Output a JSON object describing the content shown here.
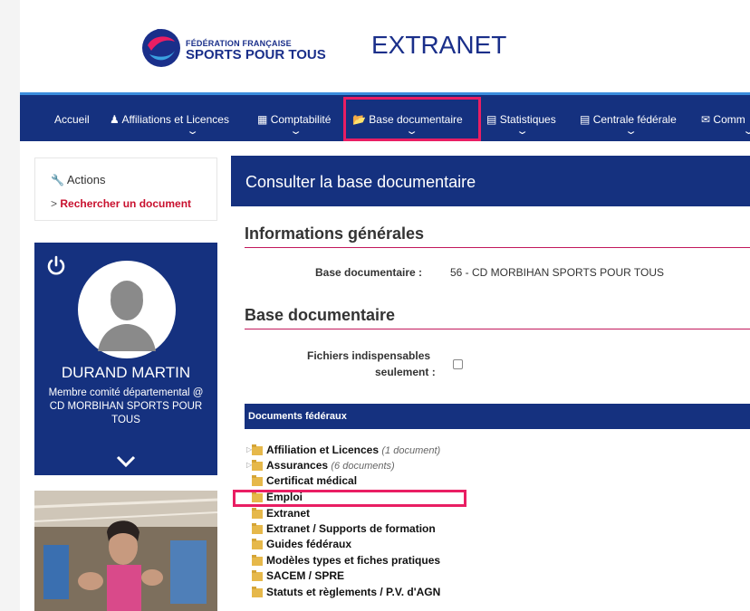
{
  "header": {
    "logo_line1": "FÉDÉRATION FRANÇAISE",
    "logo_line2": "SPORTS POUR TOUS",
    "app_title": "EXTRANET"
  },
  "nav": {
    "items": [
      {
        "label": "Accueil",
        "icon": "none"
      },
      {
        "label": "Affiliations et Licences",
        "icon": "user-icon"
      },
      {
        "label": "Comptabilité",
        "icon": "calculator-icon"
      },
      {
        "label": "Base documentaire",
        "icon": "folder-open-icon"
      },
      {
        "label": "Statistiques",
        "icon": "bar-chart-icon"
      },
      {
        "label": "Centrale fédérale",
        "icon": "list-icon"
      },
      {
        "label": "Comm",
        "icon": "envelope-icon"
      }
    ]
  },
  "sidebar": {
    "actions_title": "Actions",
    "actions_link": "Rechercher un document",
    "user_name": "DURAND MARTIN",
    "user_role": "Membre comité départemental @ CD MORBIHAN SPORTS POUR TOUS"
  },
  "main": {
    "page_title": "Consulter la base documentaire",
    "section1_title": "Informations générales",
    "base_label": "Base documentaire :",
    "base_value": "56 - CD MORBIHAN SPORTS POUR TOUS",
    "section2_title": "Base documentaire",
    "filter_label_line1": "Fichiers indispensables",
    "filter_label_line2": "seulement :",
    "filter_checked": false,
    "docs_header": "Documents fédéraux",
    "tree": [
      {
        "label": "Affiliation et Licences",
        "count": "(1 document)",
        "expandable": true
      },
      {
        "label": "Assurances",
        "count": "(6 documents)",
        "expandable": true
      },
      {
        "label": "Certificat médical",
        "count": "",
        "expandable": false
      },
      {
        "label": "Emploi",
        "count": "",
        "expandable": false
      },
      {
        "label": "Extranet",
        "count": "",
        "expandable": false
      },
      {
        "label": "Extranet / Supports de formation",
        "count": "",
        "expandable": false
      },
      {
        "label": "Guides fédéraux",
        "count": "",
        "expandable": false
      },
      {
        "label": "Modèles types et fiches pratiques",
        "count": "",
        "expandable": false
      },
      {
        "label": "SACEM / SPRE",
        "count": "",
        "expandable": false
      },
      {
        "label": "Statuts et règlements / P.V. d'AGN",
        "count": "",
        "expandable": false
      }
    ]
  },
  "colors": {
    "navy": "#15317f",
    "highlight": "#e91e63",
    "accent_red": "#c8102e"
  }
}
